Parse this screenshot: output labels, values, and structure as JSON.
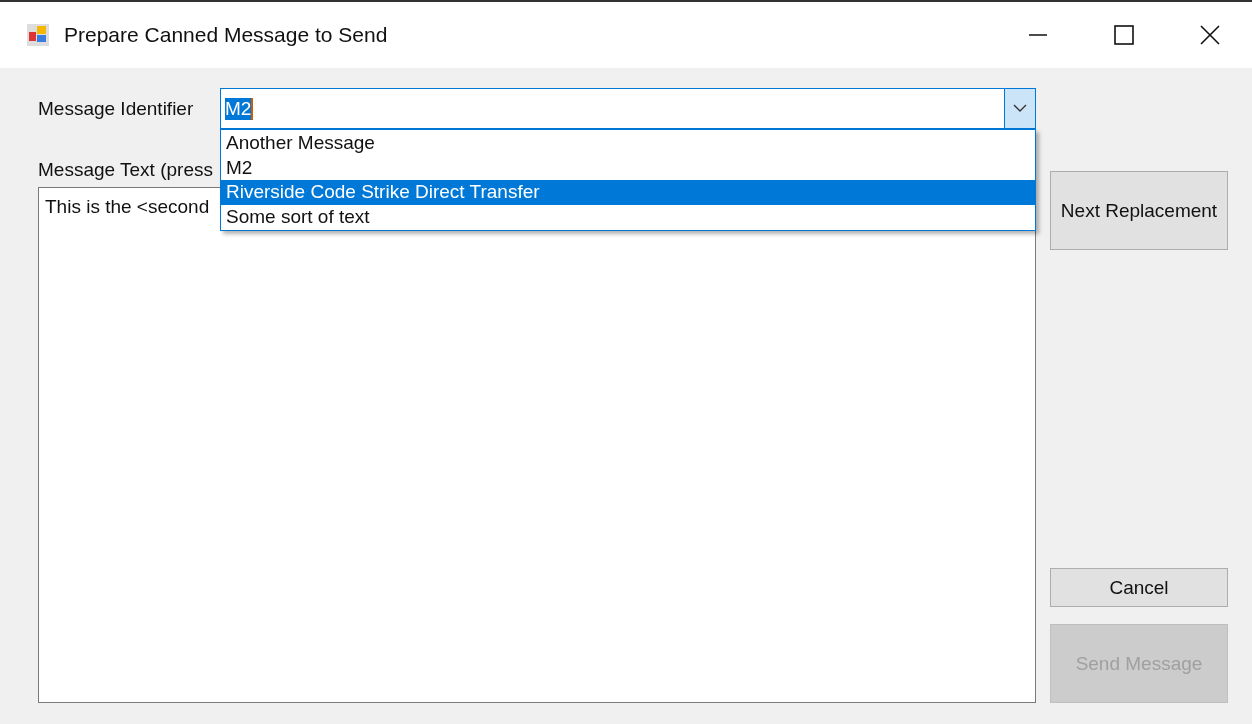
{
  "window": {
    "title": "Prepare Canned Message to Send"
  },
  "identifier": {
    "label": "Message Identifier",
    "value": "M2",
    "expanded": true,
    "options": [
      {
        "label": "Another Message",
        "highlighted": false
      },
      {
        "label": "M2",
        "highlighted": false
      },
      {
        "label": "Riverside Code Strike Direct Transfer",
        "highlighted": true
      },
      {
        "label": "Some sort of text",
        "highlighted": false
      }
    ]
  },
  "message_text": {
    "label": "Message Text (press",
    "value": "This is the <second"
  },
  "buttons": [
    {
      "label": "Next Replacement",
      "kind": "side",
      "disabled": false
    },
    {
      "label": "Cancel",
      "kind": "small",
      "disabled": false
    },
    {
      "label": "Send Message",
      "kind": "large",
      "disabled": true
    }
  ]
}
